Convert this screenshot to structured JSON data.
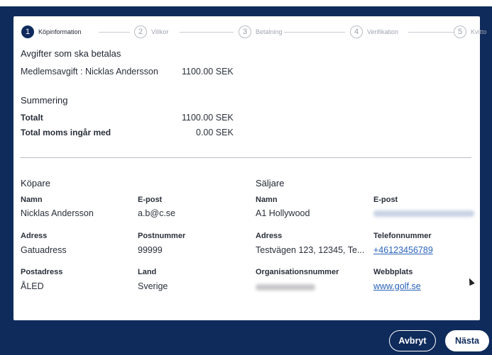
{
  "stepper": {
    "steps": [
      {
        "num": "1",
        "label": "Köpinformation"
      },
      {
        "num": "2",
        "label": "Villkor"
      },
      {
        "num": "3",
        "label": "Betalning"
      },
      {
        "num": "4",
        "label": "Verifikation"
      },
      {
        "num": "5",
        "label": "Kvitto"
      }
    ]
  },
  "fees": {
    "heading": "Avgifter som ska betalas",
    "item_label": "Medlemsavgift : Nicklas Andersson",
    "item_amount": "1100.00 SEK"
  },
  "summary": {
    "heading": "Summering",
    "total_label": "Totalt",
    "total_amount": "1100.00 SEK",
    "vat_label": "Total moms ingår med",
    "vat_amount": "0.00 SEK"
  },
  "buyer": {
    "heading": "Köpare",
    "name_label": "Namn",
    "name": "Nicklas Andersson",
    "email_label": "E-post",
    "email": "a.b@c.se",
    "address_label": "Adress",
    "address": "Gatuadress",
    "postal_code_label": "Postnummer",
    "postal_code": "99999",
    "city_label": "Postadress",
    "city": "ÅLED",
    "country_label": "Land",
    "country": "Sverige"
  },
  "seller": {
    "heading": "Säljare",
    "name_label": "Namn",
    "name": "A1 Hollywood",
    "email_label": "E-post",
    "address_label": "Adress",
    "address": "Testvägen 123, 12345, Te...",
    "phone_label": "Telefonnummer",
    "phone": "+46123456789",
    "org_label": "Organisationsnummer",
    "website_label": "Webbplats",
    "website": "www.golf.se"
  },
  "footer": {
    "cancel_label": "Avbryt",
    "next_label": "Nästa"
  },
  "colors": {
    "backdrop": "#0f2b5c",
    "link": "#2a63b8"
  }
}
